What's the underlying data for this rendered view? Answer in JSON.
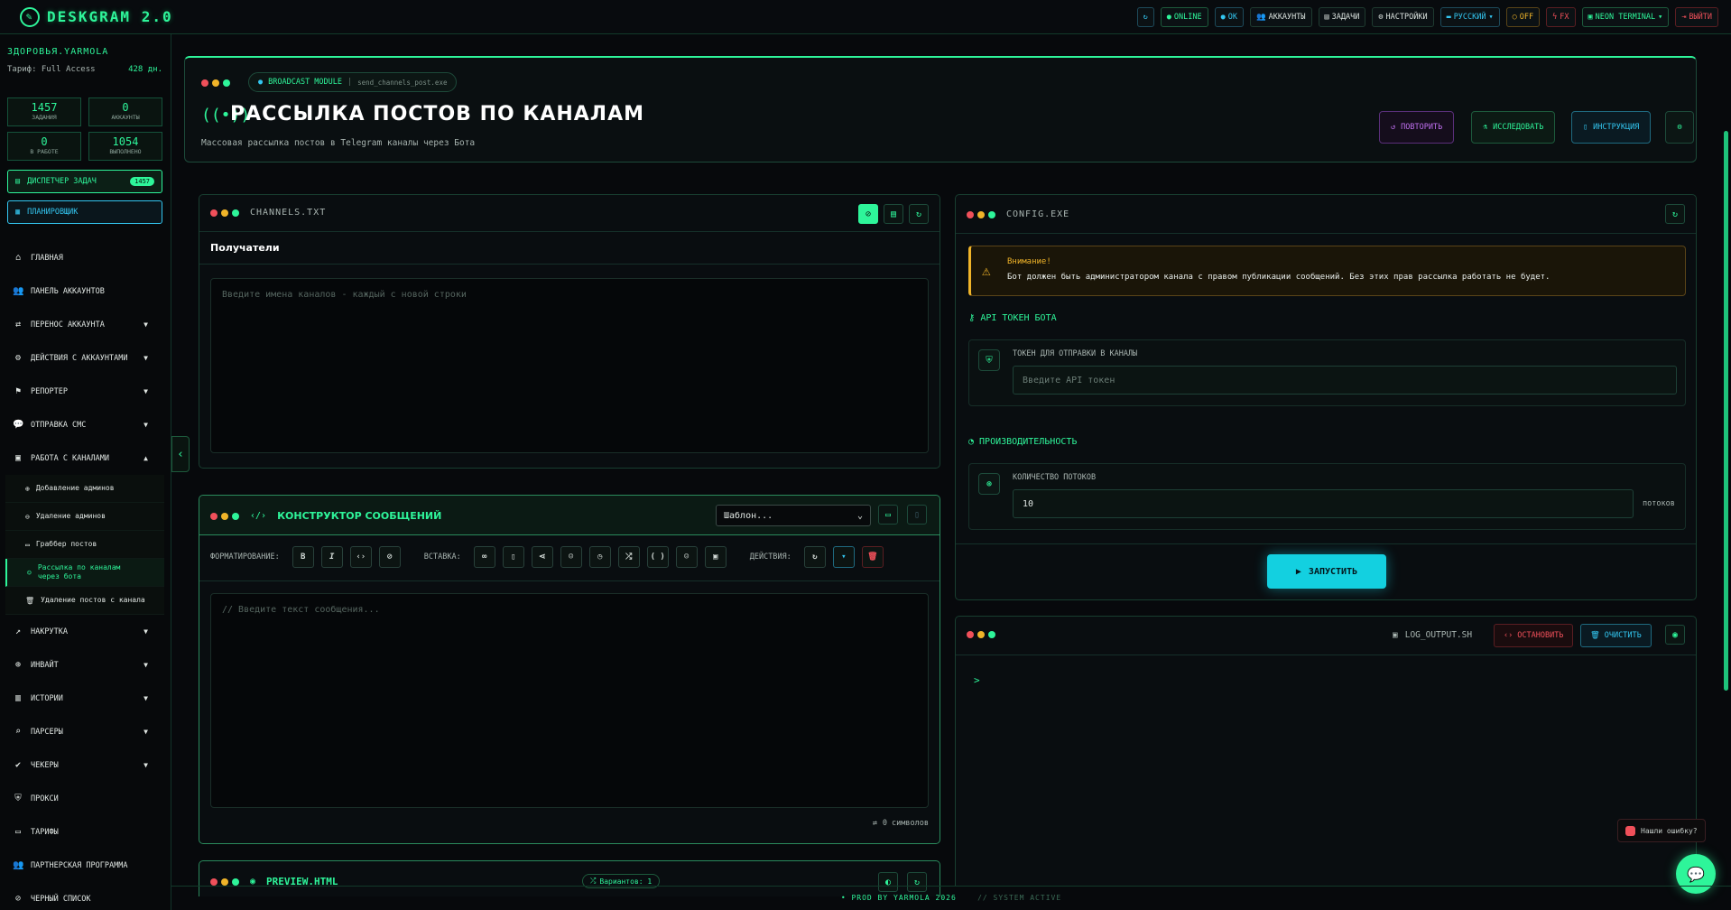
{
  "app": {
    "logo": "DESKGRAM 2.0",
    "logo_icon": "leaf-icon"
  },
  "topnav": {
    "online": "ONLINE",
    "ok": "OK",
    "accounts": "АККАУНТЫ",
    "tasks": "ЗАДАЧИ",
    "settings": "НАСТРОЙКИ",
    "language": "РУССКИЙ",
    "off": "OFF",
    "fx": "FX",
    "theme": "NEON TERMINAL",
    "logout": "ВЫЙТИ"
  },
  "user": {
    "name": "ЗДОРОВЬЯ.YARMOLA",
    "tariff_label": "Тариф: Full Access",
    "days": "428 дн."
  },
  "stats": [
    {
      "value": "1457",
      "label": "ЗАДАНИЯ"
    },
    {
      "value": "0",
      "label": "АККАУНТЫ"
    },
    {
      "value": "0",
      "label": "В РАБОТЕ"
    },
    {
      "value": "1054",
      "label": "ВЫПОЛНЕНО"
    }
  ],
  "dispatcher": {
    "label": "ДИСПЕТЧЕР ЗАДАЧ",
    "count": "1457"
  },
  "planner": {
    "label": "ПЛАНИРОВЩИК"
  },
  "menu": [
    {
      "label": "ГЛАВНАЯ",
      "icon": "home-icon"
    },
    {
      "label": "ПАНЕЛЬ АККАУНТОВ",
      "icon": "users-icon"
    },
    {
      "label": "ПЕРЕНОС АККАУНТА",
      "icon": "user-transfer-icon"
    },
    {
      "label": "ДЕЙСТВИЯ С АККАУНТАМИ",
      "icon": "user-gear-icon"
    },
    {
      "label": "РЕПОРТЕР",
      "icon": "flag-icon"
    },
    {
      "label": "ОТПРАВКА СМС",
      "icon": "chat-icon"
    },
    {
      "label": "РАБОТА С КАНАЛАМИ",
      "icon": "channel-icon"
    }
  ],
  "submenu": [
    {
      "label": "Добавление админов"
    },
    {
      "label": "Удаление админов"
    },
    {
      "label": "Граббер постов"
    },
    {
      "label": "Рассылка по каналам через бота"
    },
    {
      "label": "Удаление постов с канала"
    }
  ],
  "menu2": [
    {
      "label": "НАКРУТКА",
      "icon": "chart-icon"
    },
    {
      "label": "ИНВАЙТ",
      "icon": "user-plus-icon"
    },
    {
      "label": "ИСТОРИИ",
      "icon": "stories-icon"
    },
    {
      "label": "ПАРСЕРЫ",
      "icon": "search-icon"
    },
    {
      "label": "ЧЕКЕРЫ",
      "icon": "check-icon"
    },
    {
      "label": "ПРОКСИ",
      "icon": "shield-icon"
    },
    {
      "label": "ТАРИФЫ",
      "icon": "card-icon"
    },
    {
      "label": "ПАРТНЕРСКАЯ ПРОГРАММА",
      "icon": "partners-icon"
    },
    {
      "label": "ЧЕРНЫЙ СПИСОК",
      "icon": "blacklist-icon"
    }
  ],
  "header": {
    "module": "BROADCAST MODULE",
    "command": "send_channels_post.exe",
    "title": "РАССЫЛКА ПОСТОВ ПО КАНАЛАМ",
    "description": "Массовая рассылка постов в Telegram каналы через Бота",
    "repeat": "ПОВТОРИТЬ",
    "explore": "ИССЛЕДОВАТЬ",
    "instruction": "ИНСТРУКЦИЯ"
  },
  "channels": {
    "file": "CHANNELS.TXT",
    "label": "Получатели",
    "placeholder": "Введите имена каналов - каждый с новой строки"
  },
  "composer": {
    "title": "КОНСТРУКТОР СООБЩЕНИЙ",
    "template": "Шаблон...",
    "format_label": "ФОРМАТИРОВАНИЕ:",
    "insert_label": "ВСТАВКА:",
    "actions_label": "ДЕЙСТВИЯ:",
    "placeholder": "// Введите текст сообщения...",
    "chars": "0 символов"
  },
  "preview": {
    "title": "PREVIEW.HTML",
    "variants": "Вариантов: 1"
  },
  "config": {
    "file": "CONFIG.EXE",
    "warning_title": "Внимание!",
    "warning_text": "Бот должен быть администратором канала с правом публикации сообщений. Без этих прав рассылка работать не будет.",
    "token_section": "API ТОКЕН БОТА",
    "token_label": "ТОКЕН ДЛЯ ОТПРАВКИ В КАНАЛЫ",
    "token_placeholder": "Введите API токен",
    "perf_section": "ПРОИЗВОДИТЕЛЬНОСТЬ",
    "threads_label": "КОЛИЧЕСТВО ПОТОКОВ",
    "threads_value": "10",
    "threads_unit": "потоков",
    "start": "ЗАПУСТИТЬ"
  },
  "log": {
    "file": "LOG_OUTPUT.SH",
    "stop": "ОСТАНОВИТЬ",
    "clear": "ОЧИСТИТЬ",
    "prompt": ">"
  },
  "bug": {
    "label": "Нашли ошибку?"
  },
  "footer": {
    "text": "• PROD BY YARMOLA 2026",
    "status": "// SYSTEM ACTIVE"
  }
}
